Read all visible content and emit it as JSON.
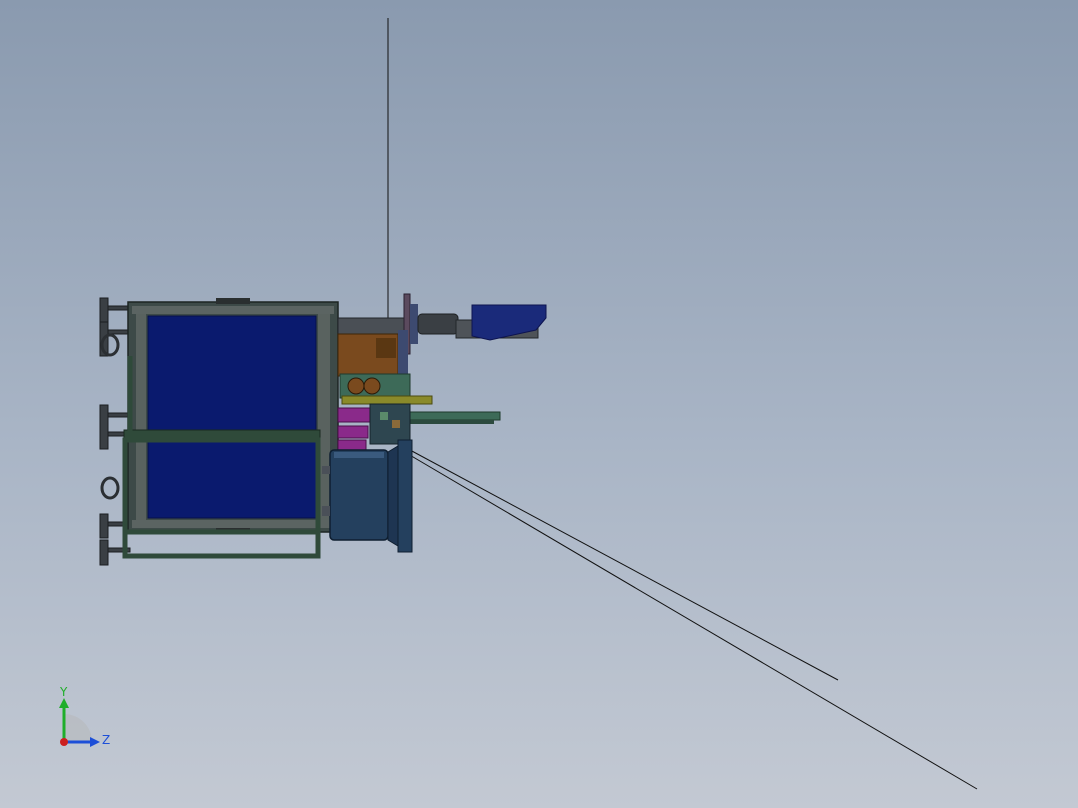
{
  "viewport": {
    "background_top": "#8a9aaf",
    "background_bottom": "#c3c9d3"
  },
  "model": {
    "panel_color": "#0a1a6e",
    "frame_color": "#2f4a3a",
    "motor_color": "#24405e",
    "bracket_color": "#7a4a1e",
    "accent_color": "#8a2a8a"
  },
  "triad": {
    "x_label": "",
    "y_label": "Y",
    "z_label": "Z",
    "y_color": "#1fae2a",
    "z_color": "#1d4fd8",
    "x_color": "#cc1f1f",
    "icon": "coordinate-triad-icon"
  }
}
